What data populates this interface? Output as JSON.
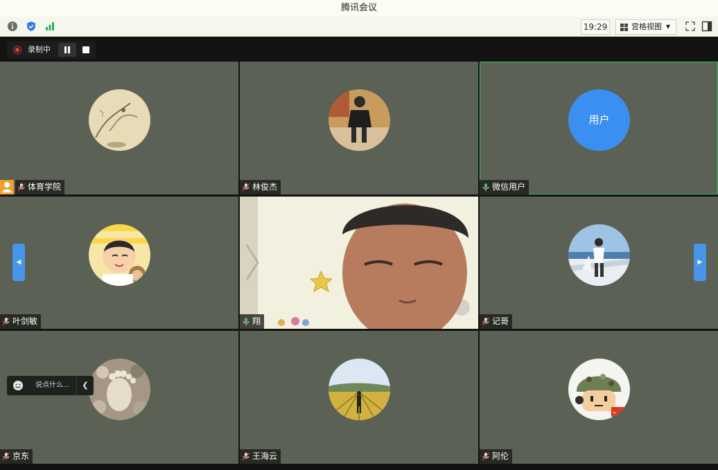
{
  "window": {
    "title": "腾讯会议"
  },
  "toolbar": {
    "icons": [
      "info-icon",
      "shield-icon",
      "signal-icon"
    ],
    "time": "19:29",
    "view_mode": "宫格视图",
    "right_icons": [
      "fullscreen-icon",
      "sidebar-toggle-icon"
    ]
  },
  "recording": {
    "label": "录制中",
    "icons": [
      "record-dot-icon",
      "pause-icon",
      "stop-icon"
    ]
  },
  "avatar_user_text": "用户",
  "participants": [
    {
      "name": "体育学院",
      "avatar": "ink-painting",
      "mic": "muted",
      "host": true
    },
    {
      "name": "林俊杰",
      "avatar": "child-photo",
      "mic": "muted"
    },
    {
      "name": "微信用户",
      "avatar": "text",
      "mic": "on",
      "active": true
    },
    {
      "name": "叶剑敏",
      "avatar": "cartoon-boy",
      "mic": "muted"
    },
    {
      "name": "翔",
      "avatar": "camera",
      "mic": "on"
    },
    {
      "name": "记哥",
      "avatar": "ship-photo",
      "mic": "muted"
    },
    {
      "name": "京东",
      "avatar": "stones-photo",
      "mic": "muted"
    },
    {
      "name": "王海云",
      "avatar": "field-photo",
      "mic": "muted"
    },
    {
      "name": "阿伦",
      "avatar": "soldier-cartoon",
      "mic": "muted"
    }
  ],
  "chat": {
    "placeholder": "说点什么...",
    "icons": [
      "emoji-icon",
      "chevron-left-icon"
    ]
  },
  "colors": {
    "tile_bg": "#5b6154",
    "accent_blue": "#3a8ff0",
    "active_border": "#3fc06c",
    "host_badge": "#f3a02b",
    "record_red": "#e2432f"
  }
}
